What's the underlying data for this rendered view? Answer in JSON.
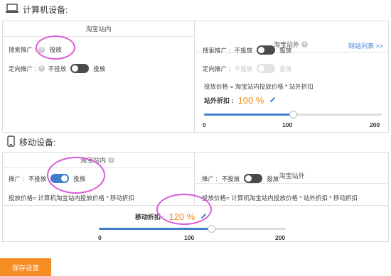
{
  "pc": {
    "title": "计算机设备:",
    "inner_header": "淘宝站内",
    "outer_header": "淘宝站外",
    "site_list_link": "网站列表 >>",
    "search_promo": {
      "label": "搜索推广 :",
      "value": "投放"
    },
    "target_promo": {
      "label": "定向推广 :",
      "off_label": "不投放",
      "on_label": "投放"
    },
    "outer_search": {
      "label": "搜索推广 :",
      "off_label": "不投放",
      "on_label": "投放"
    },
    "outer_target": {
      "label": "定向推广 :",
      "off_label": "不投放",
      "on_label": "投放"
    },
    "price_formula": "投放价格 = 淘宝站内投放价格 * 站外折扣",
    "discount_label": "站外折扣 :",
    "discount_value": "100 %",
    "slider": {
      "min": "0",
      "mid": "100",
      "max": "200",
      "value": 100,
      "range_max": 200
    }
  },
  "mobile": {
    "title": "移动设备:",
    "inner_header": "淘宝站内",
    "outer_header": "淘宝站外",
    "inner_promo": {
      "label": "推广 :",
      "off_label": "不投放",
      "on_label": "投放"
    },
    "outer_promo": {
      "label": "推广 :",
      "off_label": "不投放",
      "on_label": "投放"
    },
    "inner_formula": "投放价格= 计算机淘宝站内投放价格 * 移动折扣",
    "outer_formula": "投放价格= 计算机淘宝站内投放价格 * 站外折扣 * 移动折扣",
    "discount_label": "移动折扣 :",
    "discount_value": "120 %",
    "slider": {
      "min": "0",
      "mid": "100",
      "max": "200",
      "value": 120,
      "range_max": 200
    }
  },
  "save_button": "保存设置",
  "colors": {
    "accent": "#3f7fc9",
    "orange": "#f58d23",
    "highlight": "#d95bd9"
  }
}
